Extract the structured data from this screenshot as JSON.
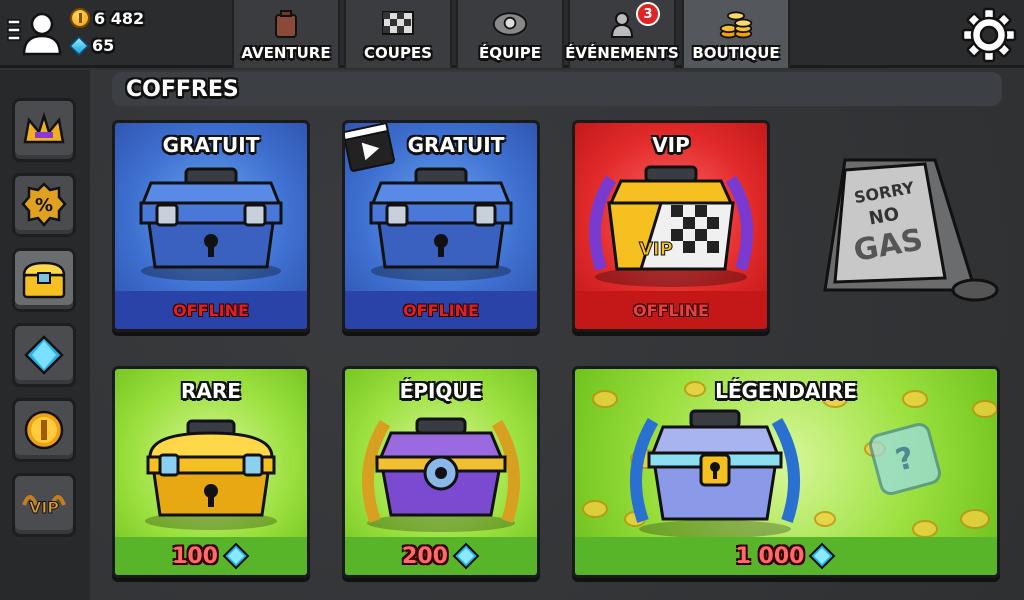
{
  "topbar": {
    "coins": "6 482",
    "gems": "65",
    "tabs": [
      {
        "label": "AVENTURE",
        "icon": "fuel-can-icon"
      },
      {
        "label": "COUPES",
        "icon": "checkered-flag-icon"
      },
      {
        "label": "ÉQUIPE",
        "icon": "team-emblem-icon"
      },
      {
        "label": "ÉVÉNEMENTS",
        "icon": "events-icon",
        "badge": "3"
      },
      {
        "label": "BOUTIQUE",
        "icon": "coin-stack-icon",
        "active": true
      }
    ]
  },
  "sidebar": {
    "items": [
      {
        "icon": "crown-icon"
      },
      {
        "icon": "discount-badge-icon"
      },
      {
        "icon": "chest-icon",
        "active": true
      },
      {
        "icon": "gem-icon"
      },
      {
        "icon": "coin-icon"
      },
      {
        "icon": "vip-badge-icon"
      }
    ]
  },
  "section": {
    "title": "COFFRES"
  },
  "sign_text": {
    "line1": "SORRY",
    "line2": "NO",
    "line3": "GAS"
  },
  "chests": [
    {
      "title": "GRATUIT",
      "status": "OFFLINE",
      "type": "free"
    },
    {
      "title": "GRATUIT",
      "status": "OFFLINE",
      "type": "free-video"
    },
    {
      "title": "VIP",
      "status": "OFFLINE",
      "type": "vip"
    },
    {
      "title": "RARE",
      "price": "100",
      "type": "rare"
    },
    {
      "title": "ÉPIQUE",
      "price": "200",
      "type": "epic"
    },
    {
      "title": "LÉGENDAIRE",
      "price": "1 000",
      "type": "legendary"
    }
  ],
  "colors": {
    "blue_card": "#3e6fd0",
    "red_card": "#e22a2a",
    "green_card": "#9be03e",
    "offline": "#e02020",
    "price": "#ff6a6a"
  }
}
